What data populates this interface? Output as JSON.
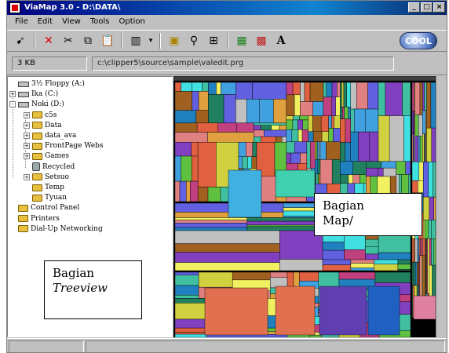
{
  "window": {
    "title": "ViaMap 3.0 - D:\\DATA\\",
    "controls": [
      "_",
      "□",
      "×"
    ]
  },
  "menu": [
    "File",
    "Edit",
    "View",
    "Tools",
    "Option"
  ],
  "toolbar": {
    "buttons": [
      "pointer-icon",
      "delete-icon",
      "cut-icon",
      "copy-icon",
      "paste-icon",
      "view-icon",
      "dropdown-icon",
      "folder-icon",
      "find-icon",
      "properties-icon",
      "map-icon",
      "colors-icon",
      "font-icon"
    ],
    "brand": "COOL"
  },
  "pathbar": {
    "size": "3 KB",
    "path": "c:\\clipper5\\source\\sample\\valedit.prg"
  },
  "tree": {
    "nodes": [
      {
        "label": "3½ Floppy (A:)",
        "icon": "drive",
        "level": 1,
        "expander": ""
      },
      {
        "label": "Ika (C:)",
        "icon": "drive",
        "level": 1,
        "expander": "+"
      },
      {
        "label": "Noki (D:)",
        "icon": "drive",
        "level": 1,
        "expander": "-"
      },
      {
        "label": "c5s",
        "icon": "folder",
        "level": 2,
        "expander": "+"
      },
      {
        "label": "Data",
        "icon": "folder",
        "level": 2,
        "expander": "+"
      },
      {
        "label": "data_ava",
        "icon": "folder",
        "level": 2,
        "expander": "+"
      },
      {
        "label": "FrontPage Webs",
        "icon": "folder",
        "level": 2,
        "expander": "+"
      },
      {
        "label": "Games",
        "icon": "folder",
        "level": 2,
        "expander": "+"
      },
      {
        "label": "Recycled",
        "icon": "bin",
        "level": 2,
        "expander": ""
      },
      {
        "label": "Setsuo",
        "icon": "folder",
        "level": 2,
        "expander": "+"
      },
      {
        "label": "Temp",
        "icon": "folder",
        "level": 2,
        "expander": ""
      },
      {
        "label": "Tyuan",
        "icon": "folder",
        "level": 2,
        "expander": ""
      },
      {
        "label": "Control Panel",
        "icon": "folder",
        "level": 1,
        "expander": ""
      },
      {
        "label": "Printers",
        "icon": "folder",
        "level": 1,
        "expander": ""
      },
      {
        "label": "Dial-Up Networking",
        "icon": "folder",
        "level": 1,
        "expander": ""
      }
    ]
  },
  "callouts": {
    "tree_label_1": "Bagian",
    "tree_label_2": "Treeview",
    "map_label_1": "Bagian",
    "map_label_2": "Map/"
  }
}
